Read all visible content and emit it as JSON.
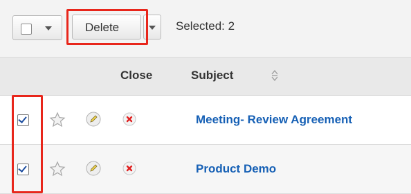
{
  "toolbar": {
    "delete_label": "Delete",
    "selected_text": "Selected: 2"
  },
  "table": {
    "columns": [
      "Close",
      "Subject"
    ],
    "rows": [
      {
        "subject": "Meeting- Review Agreement",
        "checked": true
      },
      {
        "subject": "Product Demo",
        "checked": true
      }
    ]
  },
  "colors": {
    "highlight": "#e8261b",
    "link": "#1660b5"
  },
  "icons": [
    "select-all-checkbox-icon",
    "dropdown-caret-icon",
    "sort-icon",
    "star-icon",
    "edit-pencil-icon",
    "close-x-icon",
    "checked-checkbox-icon"
  ]
}
